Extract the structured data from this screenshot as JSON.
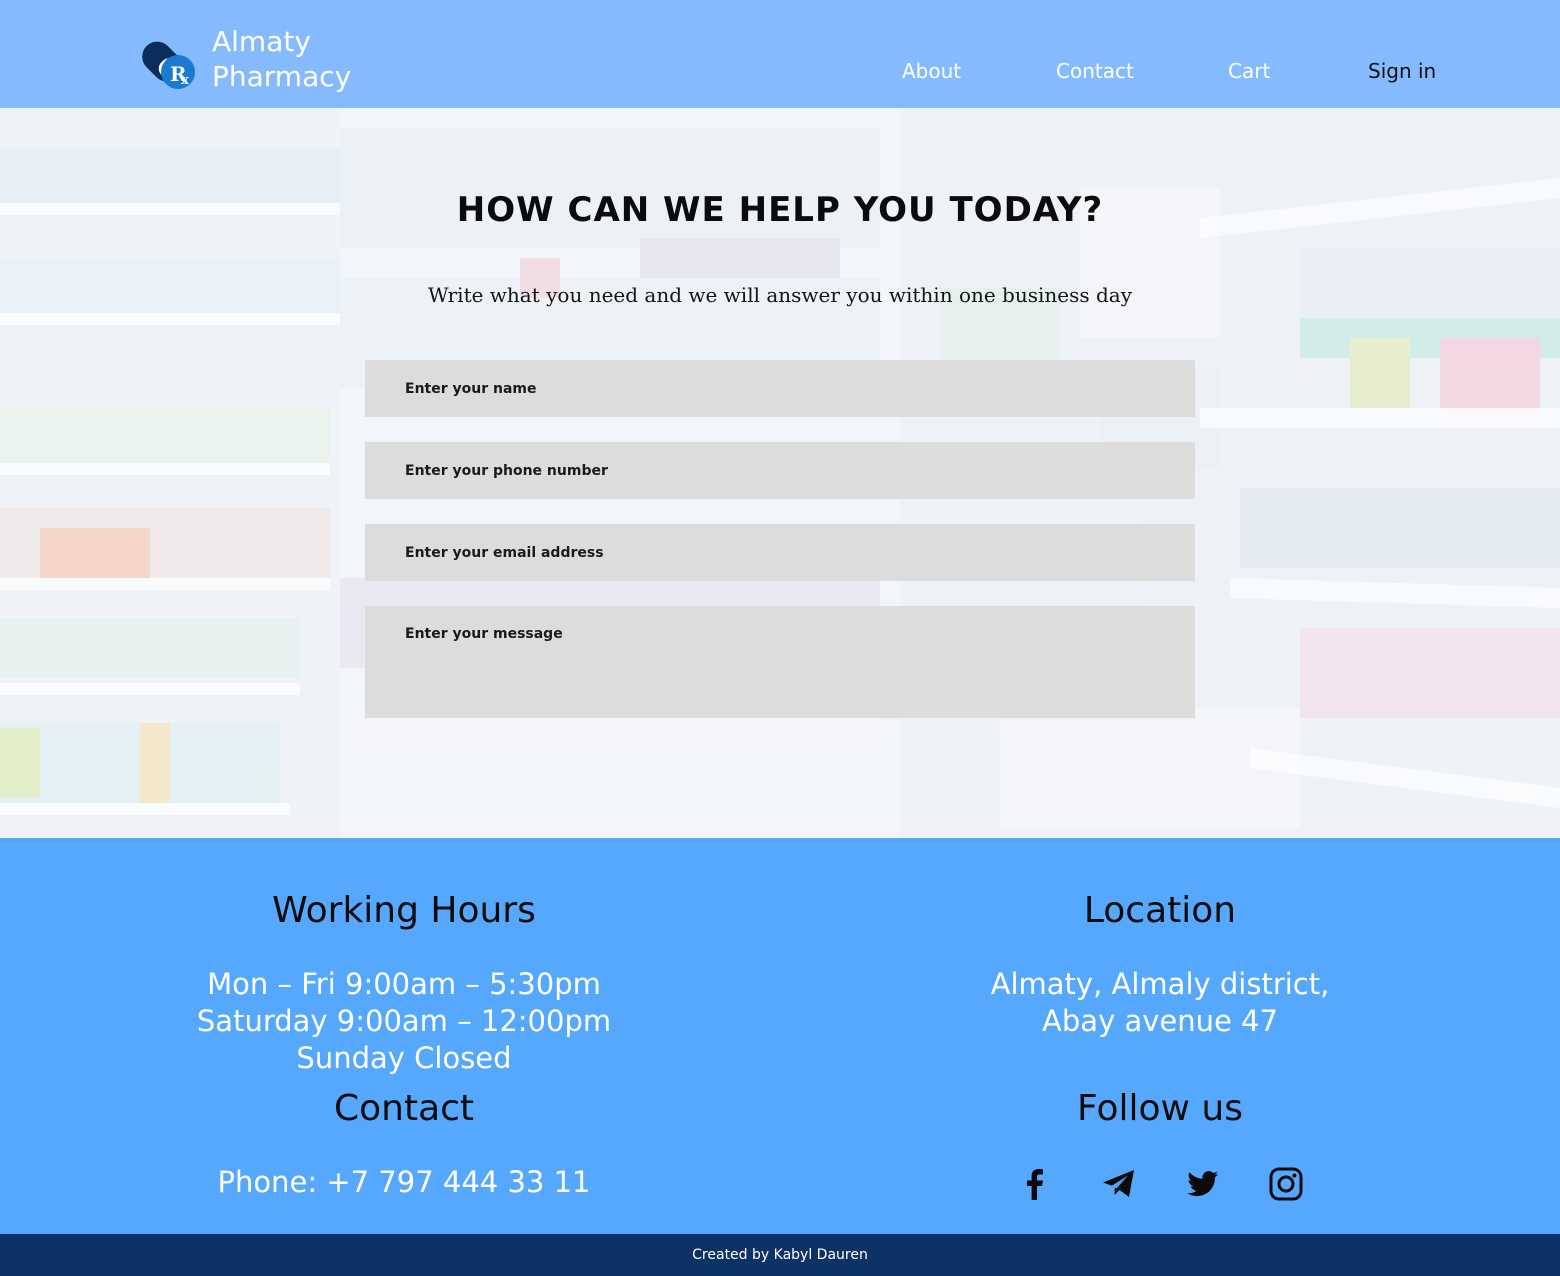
{
  "header": {
    "logo_line1": "Almaty",
    "logo_line2": "Pharmacy",
    "nav": {
      "about": "About",
      "contact": "Contact",
      "cart": "Cart",
      "signin": "Sign in"
    }
  },
  "hero": {
    "title": "HOW CAN WE HELP YOU TODAY?",
    "subtitle": "Write what you need and we will answer you within one business day"
  },
  "form": {
    "name_placeholder": "Enter your name",
    "phone_placeholder": "Enter your phone number",
    "email_placeholder": "Enter your email address",
    "message_placeholder": "Enter your message"
  },
  "working_hours": {
    "title": "Working Hours",
    "lines": [
      "Mon – Fri 9:00am – 5:30pm",
      "Saturday 9:00am – 12:00pm",
      "Sunday Closed"
    ]
  },
  "location": {
    "title": "Location",
    "lines": [
      "Almaty, Almaly district,",
      "Abay avenue 47"
    ]
  },
  "contact": {
    "title": "Contact",
    "phone": "Phone: +7 797 444 33 11"
  },
  "follow": {
    "title": "Follow us",
    "icons": [
      "facebook-icon",
      "telegram-icon",
      "twitter-icon",
      "instagram-icon"
    ]
  },
  "footer": {
    "credit": "Created by Kabyl Dauren"
  },
  "colors": {
    "header_bg": "#85bafe",
    "info_bg": "#55a8fe",
    "credit_bg": "#0c3266",
    "field_bg": "#dcdcdc"
  }
}
